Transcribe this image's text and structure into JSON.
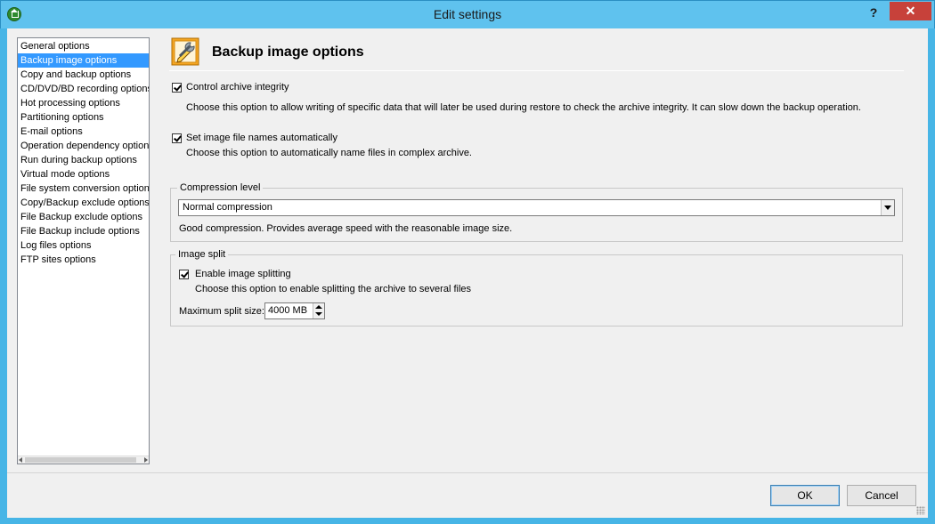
{
  "window": {
    "title": "Edit settings",
    "help_glyph": "?",
    "close_glyph": "✕"
  },
  "sidebar": {
    "items": [
      {
        "label": "General options",
        "selected": false
      },
      {
        "label": "Backup image options",
        "selected": true
      },
      {
        "label": "Copy and backup options",
        "selected": false
      },
      {
        "label": "CD/DVD/BD recording options",
        "selected": false
      },
      {
        "label": "Hot processing options",
        "selected": false
      },
      {
        "label": "Partitioning options",
        "selected": false
      },
      {
        "label": "E-mail options",
        "selected": false
      },
      {
        "label": "Operation dependency options",
        "selected": false
      },
      {
        "label": "Run during backup options",
        "selected": false
      },
      {
        "label": "Virtual mode options",
        "selected": false
      },
      {
        "label": "File system conversion options",
        "selected": false
      },
      {
        "label": "Copy/Backup exclude options",
        "selected": false
      },
      {
        "label": "File Backup exclude options",
        "selected": false
      },
      {
        "label": "File Backup include options",
        "selected": false
      },
      {
        "label": "Log files options",
        "selected": false
      },
      {
        "label": "FTP sites options",
        "selected": false
      }
    ]
  },
  "panel": {
    "title": "Backup image options",
    "icon": "settings-wrench-pencil-icon",
    "control_integrity": {
      "label": "Control archive integrity",
      "checked": true,
      "description": "Choose this option to allow writing of specific data that will later be used during restore to check the archive integrity. It can slow down the backup operation."
    },
    "auto_names": {
      "label": "Set image file names automatically",
      "checked": true,
      "description": "Choose this option to automatically name files in complex archive."
    },
    "compression": {
      "group_label": "Compression level",
      "selected": "Normal compression",
      "description": "Good compression. Provides average speed with the reasonable image size."
    },
    "image_split": {
      "group_label": "Image split",
      "enable_label": "Enable image splitting",
      "checked": true,
      "description": "Choose this option to enable splitting the archive to several files",
      "max_size_label": "Maximum split size:",
      "max_size_value": "4000 MB"
    }
  },
  "footer": {
    "ok_label": "OK",
    "cancel_label": "Cancel"
  },
  "colors": {
    "selection": "#3399ff",
    "titlebar": "#5fc2ee",
    "close_button": "#c7413a"
  }
}
